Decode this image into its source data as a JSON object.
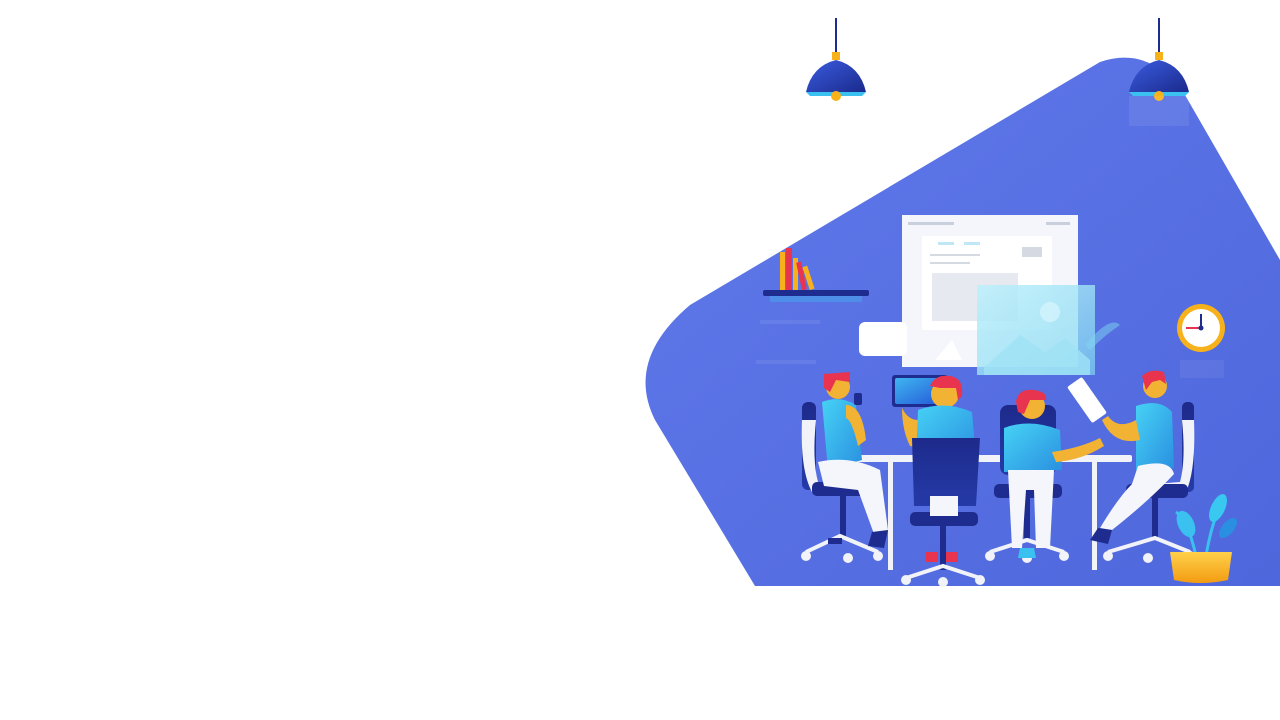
{
  "scene": {
    "description_tags": [
      "meeting",
      "team",
      "office"
    ],
    "colors": {
      "background": "#ffffff",
      "blob": "#5a73e6",
      "blob_dark": "#4b63d6",
      "navy": "#1f2c8f",
      "skin": "#f2b233",
      "hair": "#e8344e",
      "shirt_cyan": "#38c8f0",
      "white": "#ffffff",
      "pot": "#f7b21b",
      "leaf": "#3ac1ef"
    },
    "icons": [
      "pendant-lamp-icon",
      "bookshelf-icon",
      "wall-clock-icon",
      "presentation-board-icon",
      "speech-bubble-icon",
      "potted-plant-icon",
      "tablet-icon"
    ]
  }
}
